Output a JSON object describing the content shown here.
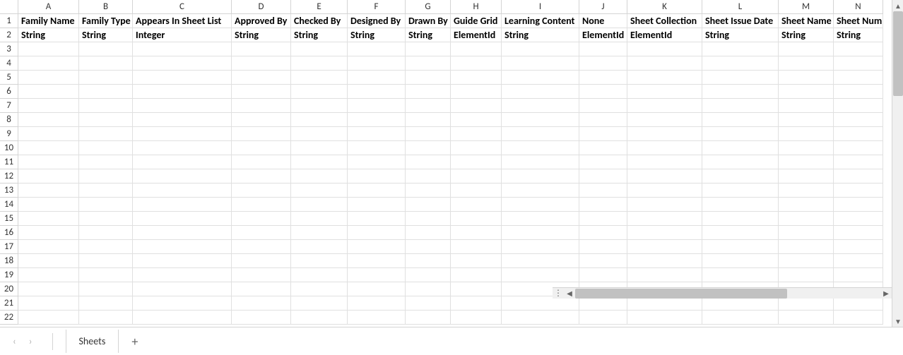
{
  "columns": [
    {
      "letter": "A",
      "width": 86
    },
    {
      "letter": "B",
      "width": 76
    },
    {
      "letter": "C",
      "width": 140
    },
    {
      "letter": "D",
      "width": 84
    },
    {
      "letter": "E",
      "width": 80
    },
    {
      "letter": "F",
      "width": 82
    },
    {
      "letter": "G",
      "width": 64
    },
    {
      "letter": "H",
      "width": 72
    },
    {
      "letter": "I",
      "width": 110
    },
    {
      "letter": "J",
      "width": 68
    },
    {
      "letter": "K",
      "width": 106
    },
    {
      "letter": "L",
      "width": 108
    },
    {
      "letter": "M",
      "width": 78
    },
    {
      "letter": "N",
      "width": 70
    }
  ],
  "row_count": 22,
  "headers_row1": [
    "Family Name",
    "Family Type",
    "Appears In Sheet List",
    "Approved By",
    "Checked By",
    "Designed By",
    "Drawn By",
    "Guide Grid",
    "Learning Content",
    "None",
    "Sheet Collection",
    "Sheet Issue Date",
    "Sheet Name",
    "Sheet Number"
  ],
  "headers_row2": [
    "String",
    "String",
    "Integer",
    "String",
    "String",
    "String",
    "String",
    "ElementId",
    "String",
    "ElementId",
    "ElementId",
    "String",
    "String",
    "String"
  ],
  "sheet_tab": "Sheets",
  "add_tab_label": "+",
  "nav_prev": "‹",
  "nav_next": "›",
  "scroll_up": "▲",
  "scroll_down": "▼",
  "scroll_left": "◀",
  "scroll_right": "▶",
  "scroll_dots": "⋮"
}
